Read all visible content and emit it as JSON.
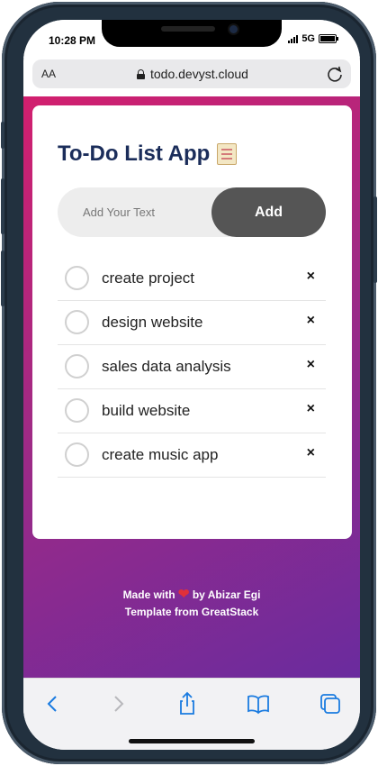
{
  "status_bar": {
    "time": "10:28 PM",
    "network": "5G"
  },
  "browser": {
    "text_size_label": "AA",
    "url": "todo.devyst.cloud",
    "icons": {
      "lock": "lock-icon",
      "reload": "reload-icon"
    }
  },
  "app": {
    "title": "To-Do List App",
    "title_icon": "notepad-icon",
    "input_placeholder": "Add Your Text",
    "add_button": "Add",
    "tasks": [
      {
        "text": "create project",
        "completed": false
      },
      {
        "text": "design website",
        "completed": false
      },
      {
        "text": "sales data analysis",
        "completed": false
      },
      {
        "text": "build website",
        "completed": false
      },
      {
        "text": "create music app",
        "completed": false
      }
    ],
    "delete_symbol": "×"
  },
  "footer": {
    "made_with": "Made with",
    "by": "by Abizar Egi",
    "template": "Template from GreatStack"
  },
  "toolbar": {
    "icons": [
      "back-icon",
      "forward-icon",
      "share-icon",
      "bookmarks-icon",
      "tabs-icon"
    ]
  },
  "colors": {
    "gradient_start": "#d21f6e",
    "gradient_end": "#6a2b9e",
    "title": "#1b2d5a",
    "add_button": "#555555",
    "ios_blue": "#1a7be0"
  }
}
